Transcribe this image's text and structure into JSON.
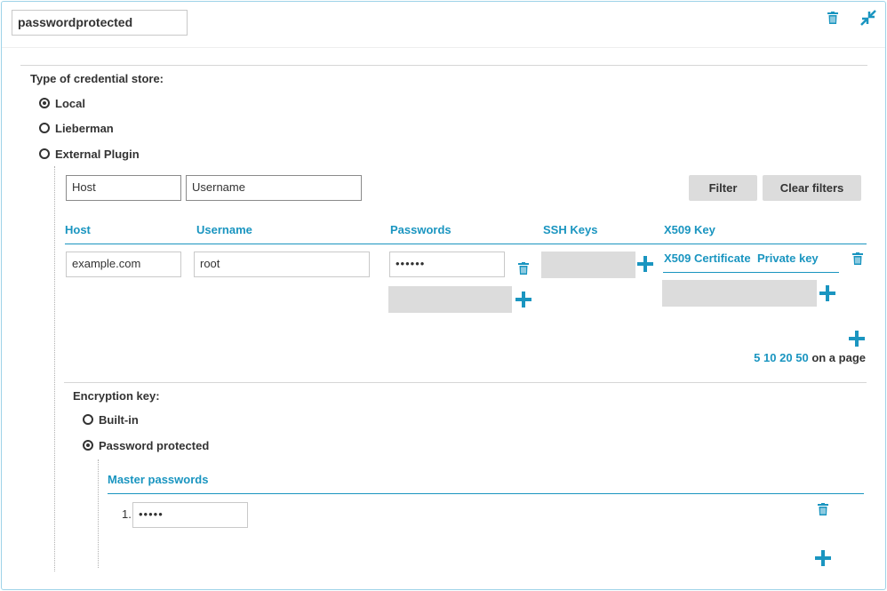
{
  "header": {
    "name_value": "passwordprotected"
  },
  "credential_store": {
    "label": "Type of credential store:",
    "options": [
      {
        "label": "Local",
        "checked": true
      },
      {
        "label": "Lieberman",
        "checked": false
      },
      {
        "label": "External Plugin",
        "checked": false
      }
    ]
  },
  "filters": {
    "host_placeholder": "Host",
    "username_placeholder": "Username",
    "filter_label": "Filter",
    "clear_label": "Clear filters"
  },
  "table": {
    "columns": {
      "host": "Host",
      "username": "Username",
      "passwords": "Passwords",
      "ssh_keys": "SSH Keys",
      "x509": "X509 Key"
    },
    "x509_sub": {
      "certificate": "X509 Certificate",
      "private_key": "Private key"
    },
    "rows": [
      {
        "host": "example.com",
        "username": "root",
        "password": "••••••"
      }
    ]
  },
  "pagination": {
    "sizes": [
      "5",
      "10",
      "20",
      "50"
    ],
    "suffix": "on a page"
  },
  "encryption": {
    "label": "Encryption key:",
    "options": [
      {
        "label": "Built-in",
        "checked": false
      },
      {
        "label": "Password protected",
        "checked": true
      }
    ],
    "master_header": "Master passwords",
    "master_items": [
      {
        "index": "1.",
        "value": "•••••"
      }
    ]
  },
  "colors": {
    "accent": "#1a95c0",
    "border": "#9ed3e8",
    "field_gray": "#dcdcdc"
  },
  "icons": [
    "trash-icon",
    "collapse-icon",
    "plus-icon"
  ]
}
